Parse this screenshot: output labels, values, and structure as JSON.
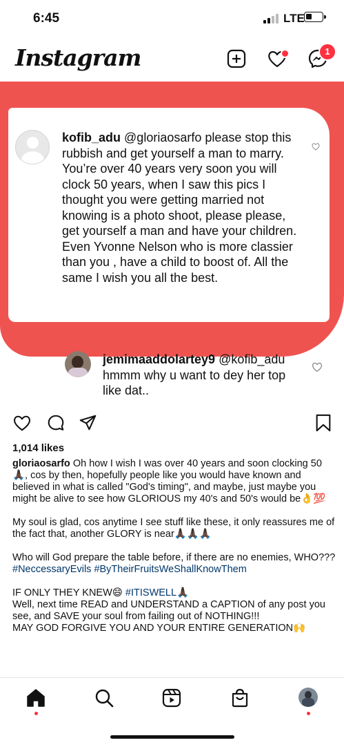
{
  "status_bar": {
    "time": "6:45",
    "network": "LTE"
  },
  "header": {
    "app_title": "Instagram",
    "messages_badge": "1"
  },
  "highlighted_comment": {
    "username": "kofib_adu",
    "text": "@gloriaosarfo please stop this rubbish and get yourself a man to marry. You’re over 40 years very soon you will clock 50 years, when I saw this pics I thought you were getting married not knowing is a photo shoot, please please, get yourself a man and have your children. Even Yvonne Nelson who is more classier than you , have a child to boost of. All the same I wish you all the best."
  },
  "reply_comment": {
    "username": "jemimaaddolartey9",
    "text": "@kofib_adu hmmm why u want to dey her top like dat.."
  },
  "post": {
    "likes": "1,014 likes",
    "caption_username": "gloriaosarfo",
    "caption_p1": "Oh how I wish I was over 40 years and soon clocking 50🙏🏿, cos by then, hopefully people like you would have known and believed in what is called \"God's timing\", and maybe, just maybe you might be alive to see how GLORIOUS my 40's and 50's would be👌💯",
    "caption_p2": "My soul is glad, cos anytime I see stuff like these, it only reassures me of the fact that, another GLORY is near🙏🏿🙏🏿🙏🏿",
    "caption_p3": "Who will God prepare the table before, if there are no enemies, WHO???",
    "hashtags": "#NeccessaryEvils #ByTheirFruitsWeShallKnowThem",
    "caption_p4a": "IF ONLY THEY KNEW😄 ",
    "caption_p4_tag": "#ITISWELL",
    "caption_p4b": "🙏🏿",
    "caption_p5": "Well, next time READ and UNDERSTAND a CAPTION of any post you see, and SAVE your soul from failing out of NOTHING!!!",
    "caption_p6": "MAY GOD FORGIVE YOU AND YOUR ENTIRE GENERATION🙌"
  },
  "icons": {
    "header": [
      "new-post-icon",
      "heart-icon",
      "messenger-icon"
    ],
    "actions": [
      "like-icon",
      "comment-icon",
      "share-icon",
      "save-icon"
    ],
    "bottom_nav": [
      "home-icon",
      "search-icon",
      "reels-icon",
      "shop-icon",
      "profile-avatar"
    ]
  },
  "colors": {
    "highlight": "#ef5350",
    "badge": "#ff3040",
    "hashtag": "#00376b"
  }
}
